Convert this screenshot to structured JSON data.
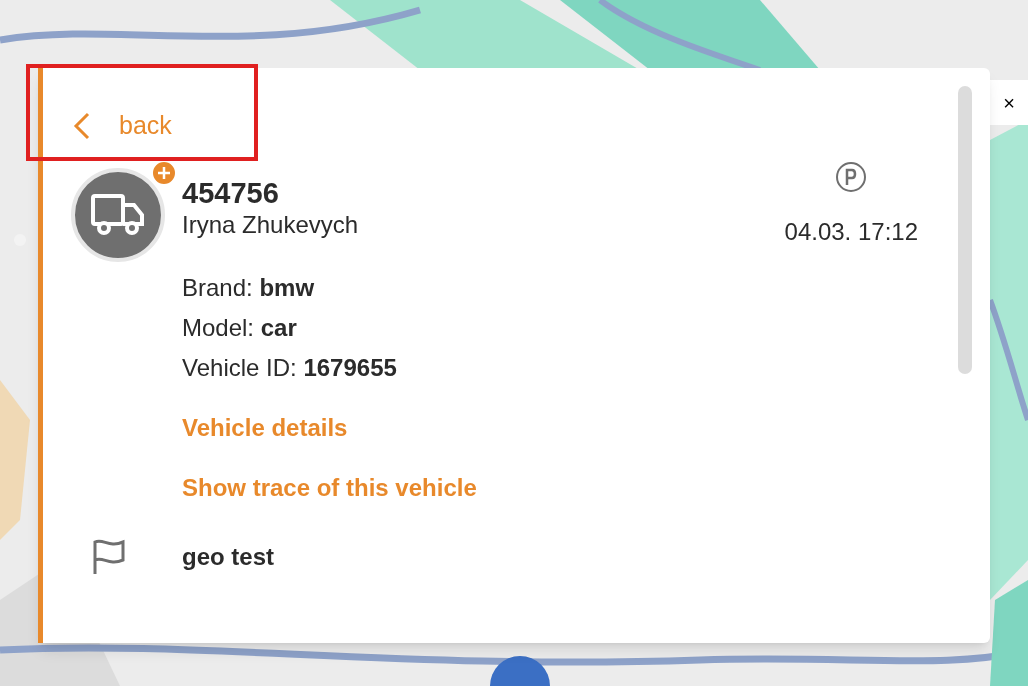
{
  "close_button": {
    "label": "×"
  },
  "back_link": {
    "label": "back",
    "highlighted": true
  },
  "vehicle": {
    "number": "454756",
    "driver": "Iryna Zhukevych",
    "time": "04.03. 17:12"
  },
  "details": [
    {
      "label": "Brand:",
      "value": "bmw"
    },
    {
      "label": "Model:",
      "value": "car"
    },
    {
      "label": "Vehicle ID:",
      "value": "1679655"
    }
  ],
  "links": [
    "Vehicle details",
    "Show trace of this vehicle"
  ],
  "geofence": {
    "name": "geo test"
  }
}
